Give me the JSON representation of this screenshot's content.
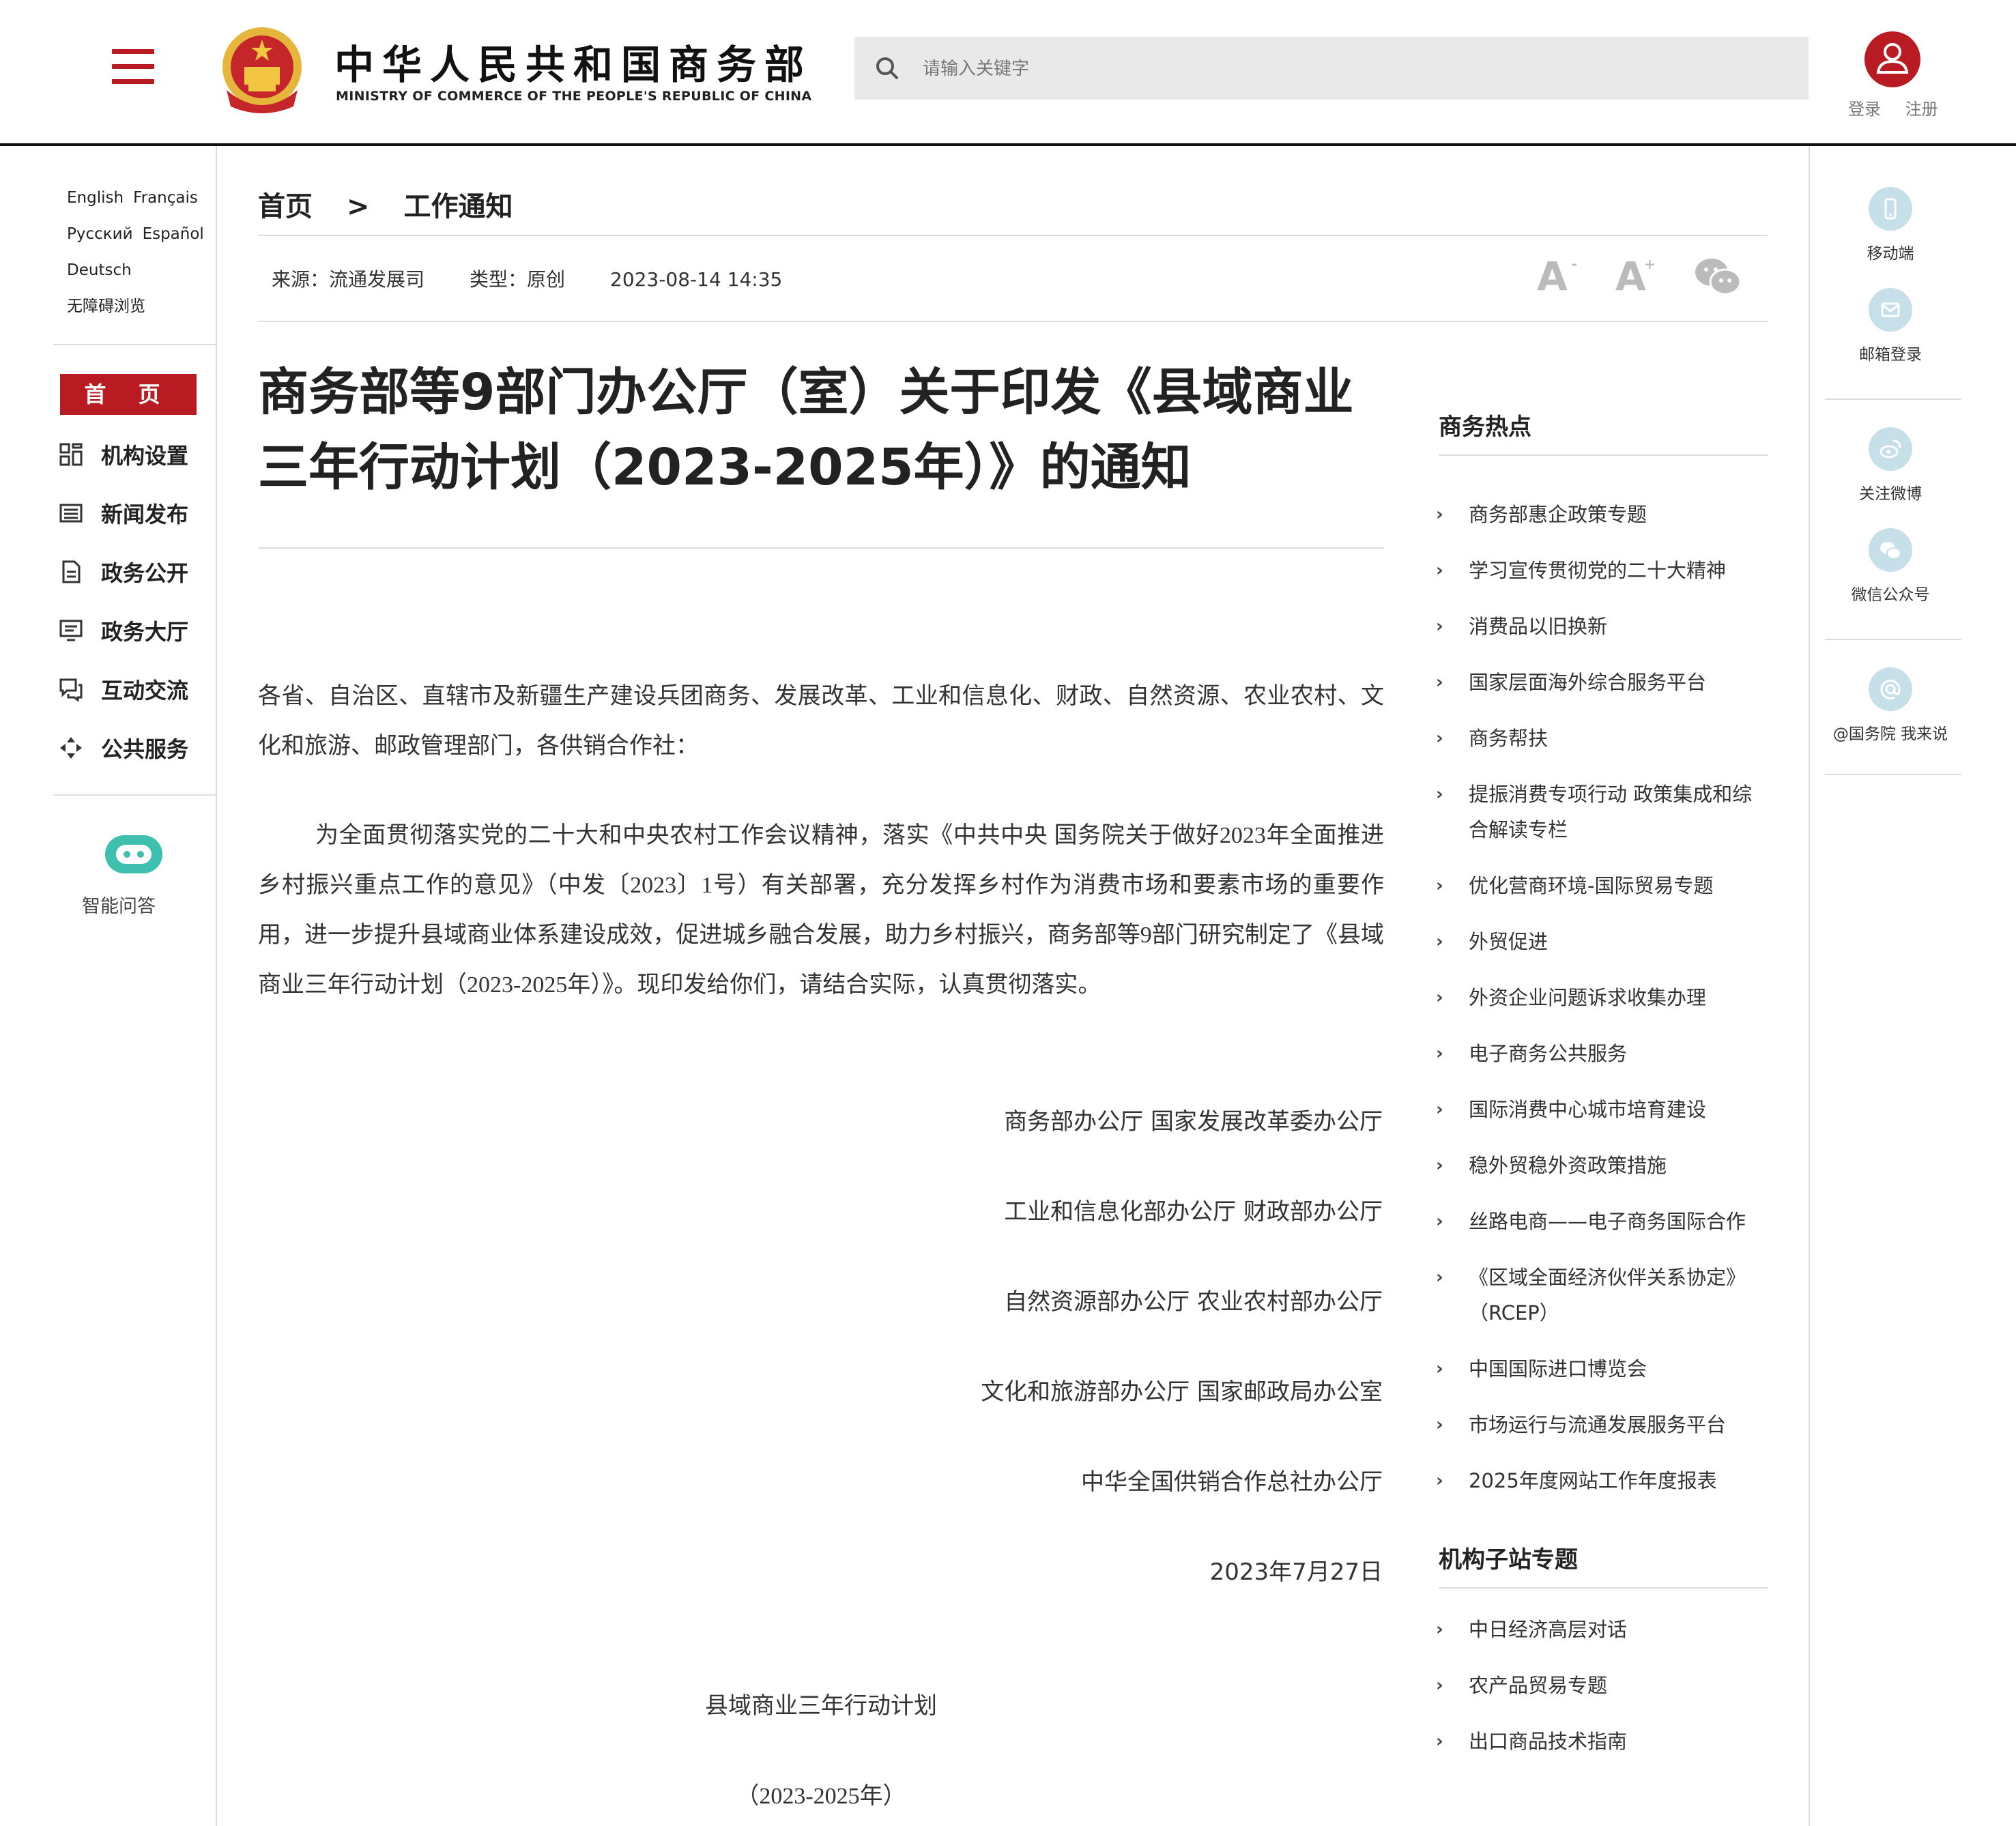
{
  "header": {
    "title": "中华人民共和国商务部",
    "subtitle": "MINISTRY OF COMMERCE OF THE PEOPLE'S REPUBLIC OF CHINA",
    "search_placeholder": "请输入关键字",
    "login": "登录",
    "register": "注册"
  },
  "left": {
    "languages": [
      "English",
      "Français",
      "Русский",
      "Español",
      "Deutsch",
      "无障碍浏览"
    ],
    "home": "首 页",
    "nav": [
      "机构设置",
      "新闻发布",
      "政务公开",
      "政务大厅",
      "互动交流",
      "公共服务"
    ],
    "ai_label": "智能问答"
  },
  "right": {
    "items": [
      "移动端",
      "邮箱登录",
      "关注微博",
      "微信公众号",
      "@国务院 我来说"
    ]
  },
  "breadcrumb": {
    "home": "首页",
    "sep": ">",
    "current": "工作通知"
  },
  "meta": {
    "source": "来源：流通发展司",
    "type": "类型：原创",
    "date": "2023-08-14 14:35"
  },
  "tools": {
    "small": "A",
    "large": "A",
    "plus": "+"
  },
  "article": {
    "title": "商务部等9部门办公厅（室）关于印发《县域商业三年行动计划（2023-2025年）》的通知",
    "salutation": "各省、自治区、直辖市及新疆生产建设兵团商务、发展改革、工业和信息化、财政、自然资源、农业农村、文化和旅游、邮政管理部门，各供销合作社：",
    "body": "为全面贯彻落实党的二十大和中央农村工作会议精神，落实《中共中央 国务院关于做好2023年全面推进乡村振兴重点工作的意见》（中发〔2023〕1号）有关部署，充分发挥乡村作为消费市场和要素市场的重要作用，进一步提升县域商业体系建设成效，促进城乡融合发展，助力乡村振兴，商务部等9部门研究制定了《县域商业三年行动计划（2023-2025年）》。现印发给你们，请结合实际，认真贯彻落实。",
    "signatures": [
      "商务部办公厅 国家发展改革委办公厅",
      "工业和信息化部办公厅 财政部办公厅",
      "自然资源部办公厅 农业农村部办公厅",
      "文化和旅游部办公厅 国家邮政局办公室",
      "中华全国供销合作总社办公厅",
      "2023年7月27日"
    ],
    "plan_title": "县域商业三年行动计划",
    "plan_years": "（2023-2025年）"
  },
  "hot": {
    "title": "商务热点",
    "items": [
      "商务部惠企政策专题",
      "学习宣传贯彻党的二十大精神",
      "消费品以旧换新",
      "国家层面海外综合服务平台",
      "商务帮扶",
      "提振消费专项行动 政策集成和综合解读专栏",
      "优化营商环境-国际贸易专题",
      "外贸促进",
      "外资企业问题诉求收集办理",
      "电子商务公共服务",
      "国际消费中心城市培育建设",
      "稳外贸稳外资政策措施",
      "丝路电商——电子商务国际合作",
      "《区域全面经济伙伴关系协定》（RCEP）",
      "中国国际进口博览会",
      "市场运行与流通发展服务平台",
      "2025年度网站工作年度报表"
    ]
  },
  "sub": {
    "title": "机构子站专题",
    "items": [
      "中日经济高层对话",
      "农产品贸易专题",
      "出口商品技术指南"
    ]
  },
  "colors": {
    "brand_red": "#b81c22",
    "accent_blue": "#c6dfe8"
  }
}
